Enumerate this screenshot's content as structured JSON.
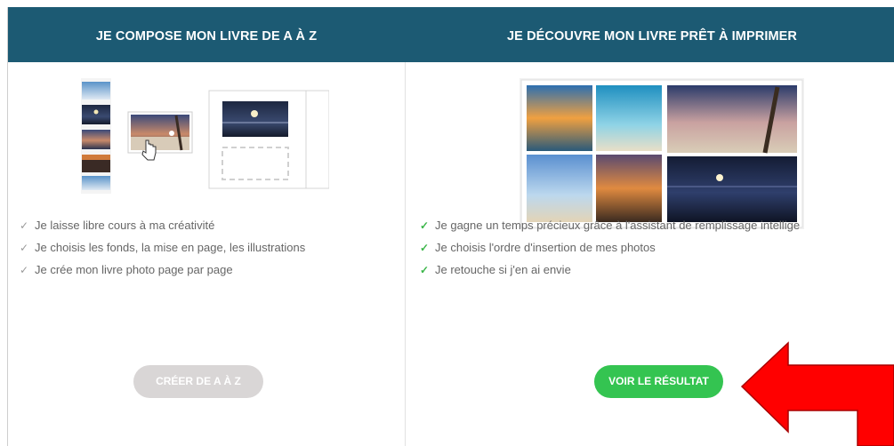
{
  "left_column": {
    "title": "JE COMPOSE MON LIVRE DE A À Z",
    "features": [
      "Je laisse libre cours à ma créativité",
      "Je choisis les fonds, la mise en page, les illustrations",
      "Je crée mon livre photo page par page"
    ],
    "button_label": "CRÉER DE A À Z"
  },
  "right_column": {
    "title": "JE DÉCOUVRE MON LIVRE PRÊT À IMPRIMER",
    "features": [
      "Je gagne un temps précieux grâce à l'assistant de remplissage intellige",
      "Je choisis l'ordre d'insertion de mes photos",
      "Je retouche si j'en ai envie"
    ],
    "button_label": "VOIR LE RÉSULTAT"
  },
  "icons": {
    "check": "✓",
    "checkmark_icon_name": "check-icon",
    "cursor_icon_name": "hand-cursor-icon",
    "arrow_icon_name": "red-arrow-annotation"
  },
  "colors": {
    "header_bg": "#1c5a73",
    "green_button": "#34c451",
    "grey_button": "#d9d6d6",
    "check_green": "#3cb64a",
    "arrow_red": "#ff0000"
  }
}
